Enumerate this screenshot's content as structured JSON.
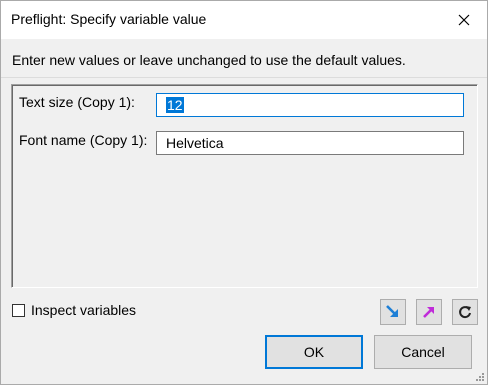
{
  "window": {
    "title": "Preflight: Specify variable value"
  },
  "instructions": "Enter new values or leave unchanged to use the default values.",
  "fields": [
    {
      "label": "Text size (Copy 1):",
      "value": "12",
      "selected": true
    },
    {
      "label": "Font name (Copy 1):",
      "value": "Helvetica",
      "selected": false
    }
  ],
  "inspect": {
    "label": "Inspect variables",
    "checked": false
  },
  "icons": [
    "import-arrow-icon",
    "export-arrow-icon",
    "reset-icon"
  ],
  "buttons": {
    "ok": "OK",
    "cancel": "Cancel"
  },
  "colors": {
    "accent": "#0078d7",
    "arrow_blue": "#1e7fd6",
    "arrow_magenta": "#c02bd9"
  }
}
